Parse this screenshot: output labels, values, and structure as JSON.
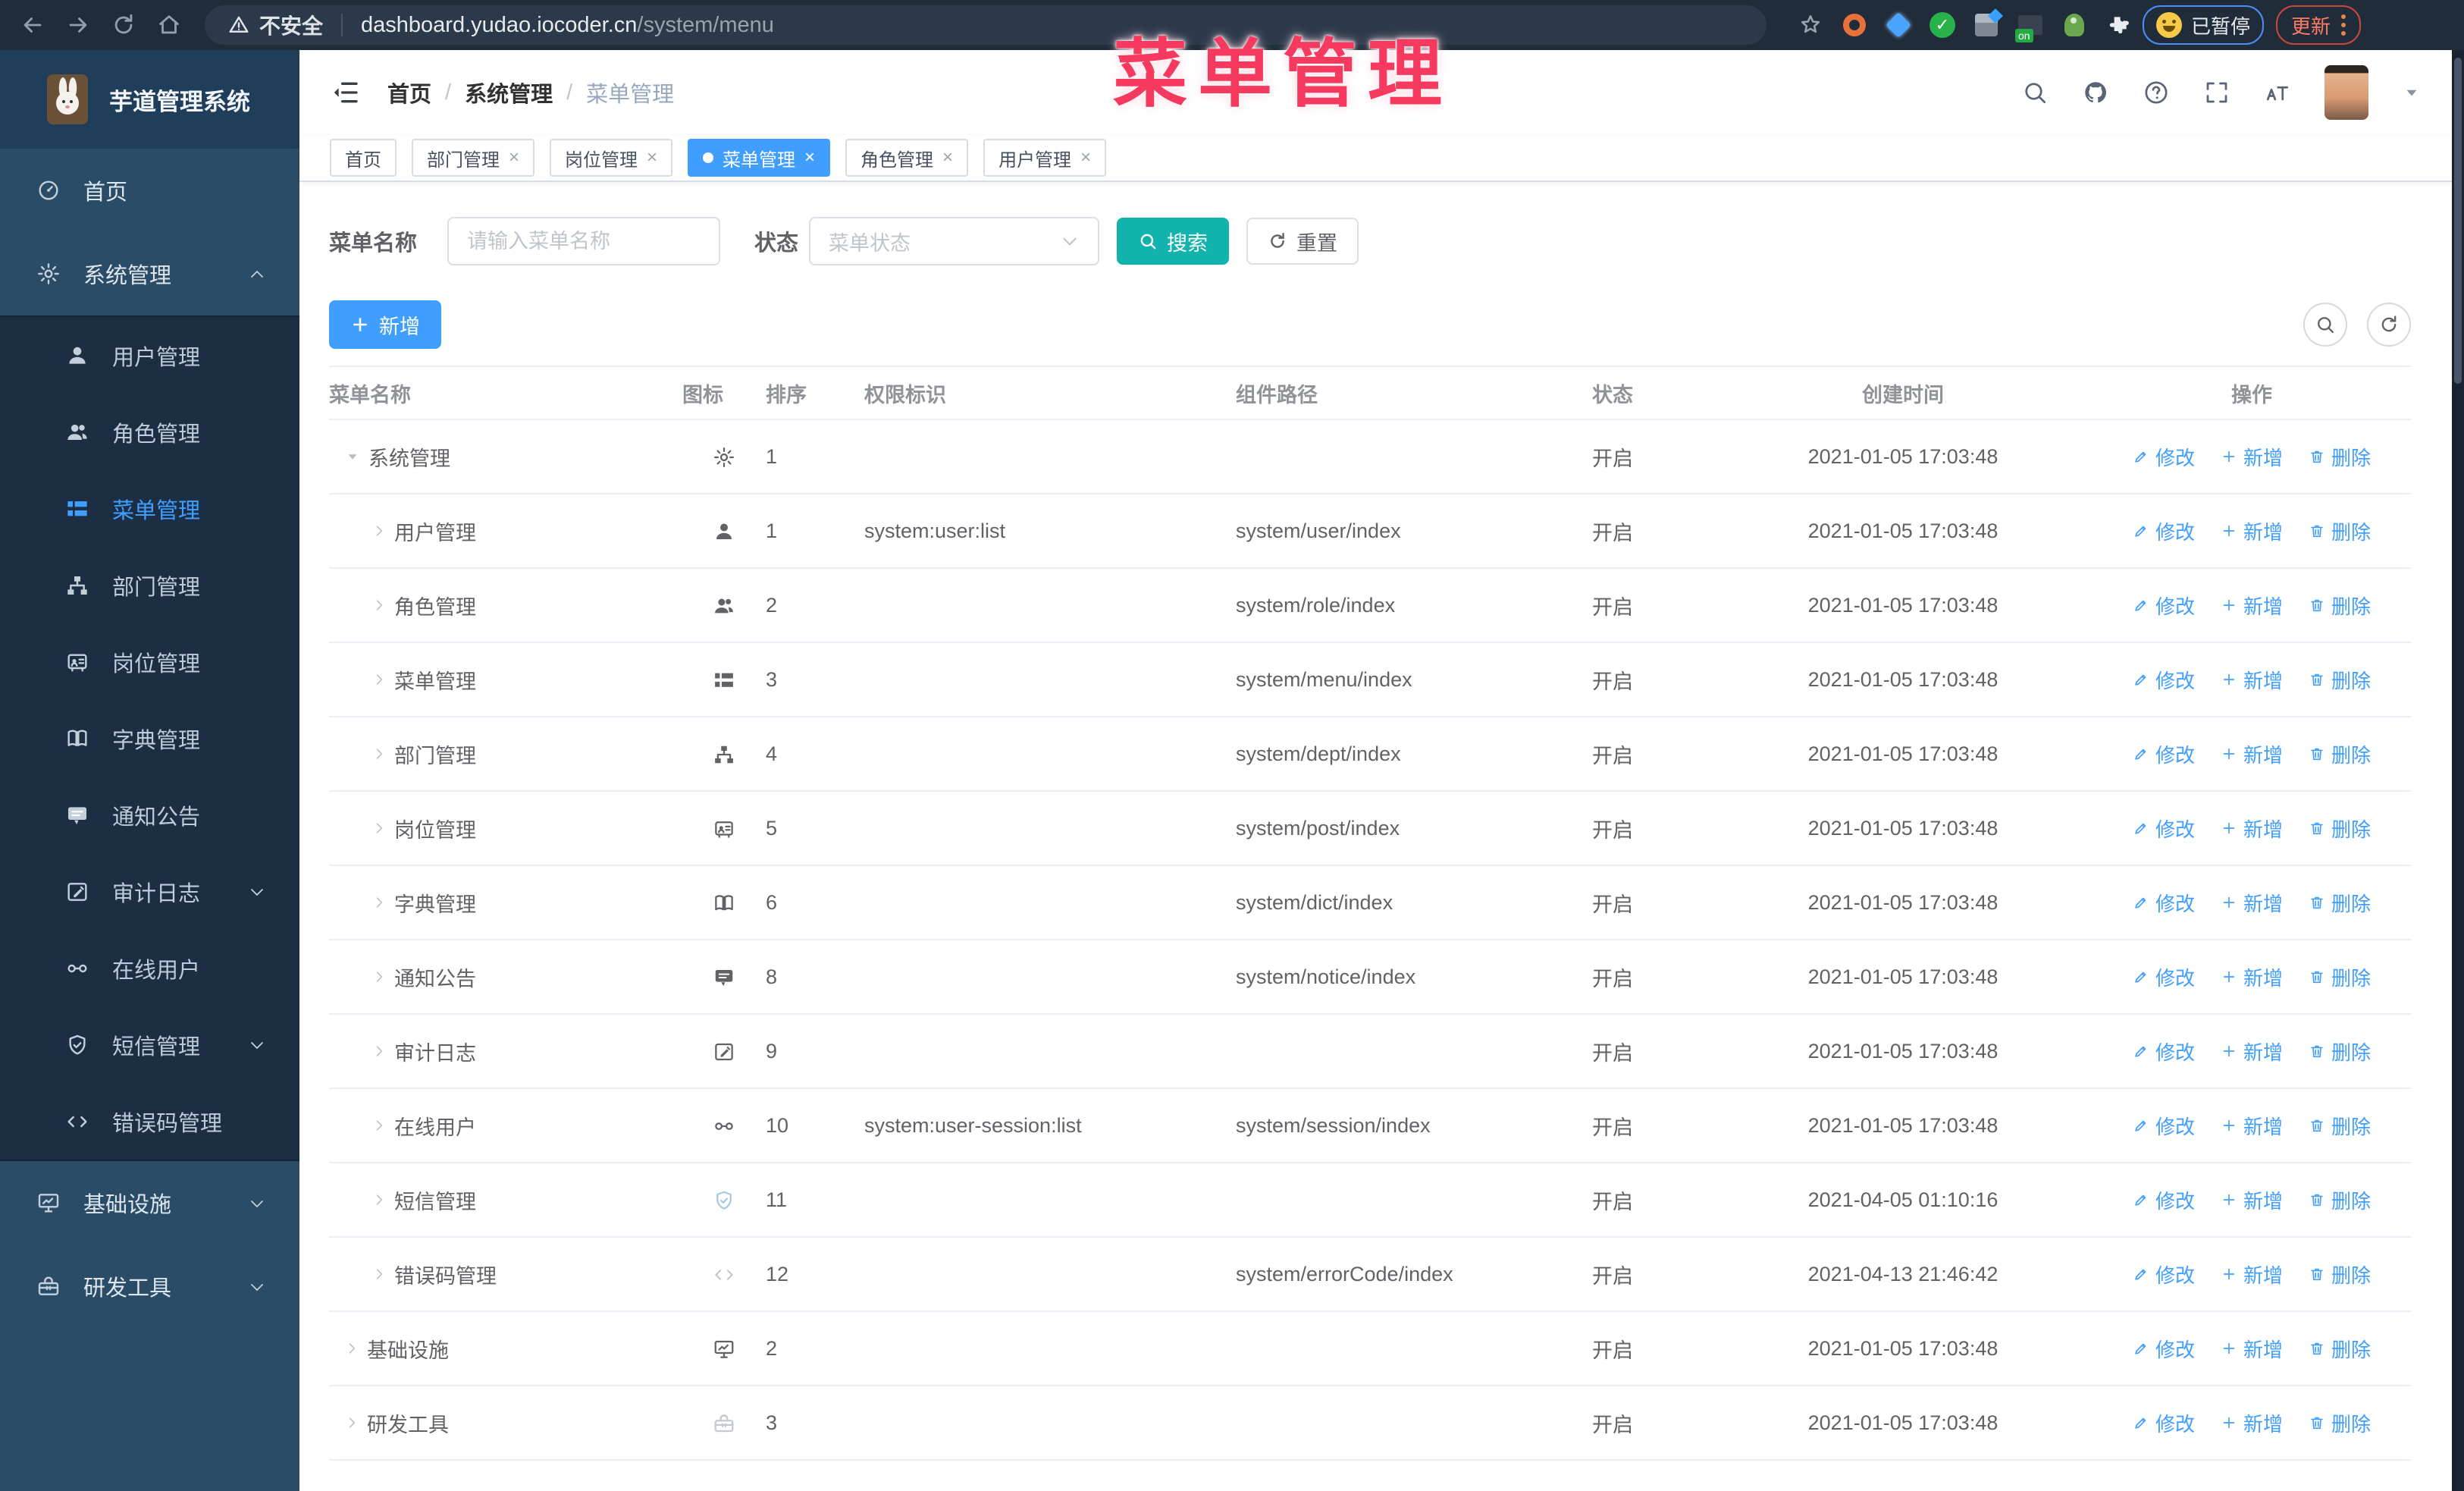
{
  "browser": {
    "security_label": "不安全",
    "url_host": "dashboard.yudao.iocoder.cn",
    "url_path": "/system/menu",
    "paused_badge": "已暂停",
    "update_button": "更新",
    "extensions": [
      {
        "key": "star",
        "name": "bookmark-star-icon"
      },
      {
        "key": "orange-ring",
        "name": "extension-orange-icon"
      },
      {
        "key": "blue-gem",
        "name": "extension-blue-icon"
      },
      {
        "key": "green-check",
        "name": "extension-green-check-icon"
      },
      {
        "key": "grid-diamond",
        "name": "extension-grid-icon"
      },
      {
        "key": "on-badge",
        "name": "extension-on-icon",
        "badge": "on"
      },
      {
        "key": "green-fig",
        "name": "extension-green-icon"
      },
      {
        "key": "puzzle",
        "name": "extensions-puzzle-icon"
      }
    ]
  },
  "overlay_title": "菜单管理",
  "colors": {
    "accent": "#409eff",
    "teal": "#11b3ac",
    "pink_title": "#f5395f",
    "sidebar_bg": "#2a4c66",
    "submenu_bg": "#1c2e44",
    "browser_bar_bg": "#212c3b"
  },
  "sidebar": {
    "logo_title": "芋道管理系统",
    "items": [
      {
        "key": "home",
        "label": "首页",
        "icon": "dashboard",
        "type": "root"
      },
      {
        "key": "system-mgmt",
        "label": "系统管理",
        "icon": "gear",
        "type": "root",
        "arrow": "up"
      },
      {
        "key": "user-mgmt",
        "label": "用户管理",
        "icon": "user",
        "type": "sub"
      },
      {
        "key": "role-mgmt",
        "label": "角色管理",
        "icon": "users",
        "type": "sub"
      },
      {
        "key": "menu-mgmt",
        "label": "菜单管理",
        "icon": "menu",
        "type": "sub",
        "active": true
      },
      {
        "key": "dept-mgmt",
        "label": "部门管理",
        "icon": "tree",
        "type": "sub"
      },
      {
        "key": "post-mgmt",
        "label": "岗位管理",
        "icon": "badge",
        "type": "sub"
      },
      {
        "key": "dict-mgmt",
        "label": "字典管理",
        "icon": "book",
        "type": "sub"
      },
      {
        "key": "notice",
        "label": "通知公告",
        "icon": "message",
        "type": "sub"
      },
      {
        "key": "audit-log",
        "label": "审计日志",
        "icon": "log",
        "type": "sub",
        "arrow": "down"
      },
      {
        "key": "online-user",
        "label": "在线用户",
        "icon": "link",
        "type": "sub"
      },
      {
        "key": "sms-mgmt",
        "label": "短信管理",
        "icon": "shield",
        "type": "sub",
        "arrow": "down"
      },
      {
        "key": "errcode-mgmt",
        "label": "错误码管理",
        "icon": "code",
        "type": "sub"
      },
      {
        "key": "infra",
        "label": "基础设施",
        "icon": "monitor",
        "type": "root",
        "arrow": "down"
      },
      {
        "key": "dev-tool",
        "label": "研发工具",
        "icon": "toolbox",
        "type": "root",
        "arrow": "down"
      }
    ]
  },
  "header": {
    "breadcrumb": [
      "首页",
      "系统管理",
      "菜单管理"
    ],
    "right_icons": [
      "search",
      "github",
      "question",
      "fullscreen",
      "fontsize"
    ]
  },
  "tabs": [
    {
      "key": "home",
      "label": "首页",
      "closable": false,
      "active": false
    },
    {
      "key": "dept",
      "label": "部门管理",
      "closable": true,
      "active": false
    },
    {
      "key": "post",
      "label": "岗位管理",
      "closable": true,
      "active": false
    },
    {
      "key": "menu",
      "label": "菜单管理",
      "closable": true,
      "active": true
    },
    {
      "key": "role",
      "label": "角色管理",
      "closable": true,
      "active": false
    },
    {
      "key": "user",
      "label": "用户管理",
      "closable": true,
      "active": false
    }
  ],
  "filters": {
    "name_label": "菜单名称",
    "name_placeholder": "请输入菜单名称",
    "status_label": "状态",
    "status_placeholder": "菜单状态",
    "search_label": "搜索",
    "reset_label": "重置"
  },
  "toolbar": {
    "add_label": "新增"
  },
  "table": {
    "columns": [
      "菜单名称",
      "图标",
      "排序",
      "权限标识",
      "组件路径",
      "状态",
      "创建时间",
      "操作"
    ],
    "actions": [
      {
        "key": "edit",
        "label": "修改",
        "icon": "edit"
      },
      {
        "key": "add",
        "label": "新增",
        "icon": "plus"
      },
      {
        "key": "delete",
        "label": "删除",
        "icon": "trash"
      }
    ],
    "rows": [
      {
        "key": "system",
        "name": "系统管理",
        "icon": "gear",
        "level": 0,
        "expanded": true,
        "order": "1",
        "perm": "",
        "path": "",
        "status": "开启",
        "created": "2021-01-05 17:03:48"
      },
      {
        "key": "user",
        "name": "用户管理",
        "icon": "user",
        "level": 1,
        "order": "1",
        "perm": "system:user:list",
        "path": "system/user/index",
        "status": "开启",
        "created": "2021-01-05 17:03:48"
      },
      {
        "key": "role",
        "name": "角色管理",
        "icon": "users",
        "level": 1,
        "order": "2",
        "perm": "",
        "path": "system/role/index",
        "status": "开启",
        "created": "2021-01-05 17:03:48"
      },
      {
        "key": "menu",
        "name": "菜单管理",
        "icon": "menu",
        "level": 1,
        "order": "3",
        "perm": "",
        "path": "system/menu/index",
        "status": "开启",
        "created": "2021-01-05 17:03:48"
      },
      {
        "key": "dept",
        "name": "部门管理",
        "icon": "tree",
        "level": 1,
        "order": "4",
        "perm": "",
        "path": "system/dept/index",
        "status": "开启",
        "created": "2021-01-05 17:03:48"
      },
      {
        "key": "post",
        "name": "岗位管理",
        "icon": "badge",
        "level": 1,
        "order": "5",
        "perm": "",
        "path": "system/post/index",
        "status": "开启",
        "created": "2021-01-05 17:03:48"
      },
      {
        "key": "dict",
        "name": "字典管理",
        "icon": "book",
        "level": 1,
        "order": "6",
        "perm": "",
        "path": "system/dict/index",
        "status": "开启",
        "created": "2021-01-05 17:03:48"
      },
      {
        "key": "notice",
        "name": "通知公告",
        "icon": "message",
        "level": 1,
        "order": "8",
        "perm": "",
        "path": "system/notice/index",
        "status": "开启",
        "created": "2021-01-05 17:03:48"
      },
      {
        "key": "audit",
        "name": "审计日志",
        "icon": "log",
        "level": 1,
        "order": "9",
        "perm": "",
        "path": "",
        "status": "开启",
        "created": "2021-01-05 17:03:48"
      },
      {
        "key": "online",
        "name": "在线用户",
        "icon": "link",
        "level": 1,
        "order": "10",
        "perm": "system:user-session:list",
        "path": "system/session/index",
        "status": "开启",
        "created": "2021-01-05 17:03:48"
      },
      {
        "key": "sms",
        "name": "短信管理",
        "icon": "shield",
        "level": 1,
        "order": "11",
        "perm": "",
        "path": "",
        "status": "开启",
        "created": "2021-04-05 01:10:16",
        "icon_tone": "muted-blue"
      },
      {
        "key": "errcode",
        "name": "错误码管理",
        "icon": "code",
        "level": 1,
        "order": "12",
        "perm": "",
        "path": "system/errorCode/index",
        "status": "开启",
        "created": "2021-04-13 21:46:42",
        "icon_tone": "muted-gray"
      },
      {
        "key": "infra",
        "name": "基础设施",
        "icon": "monitor",
        "level": 0,
        "order": "2",
        "perm": "",
        "path": "",
        "status": "开启",
        "created": "2021-01-05 17:03:48"
      },
      {
        "key": "devtool",
        "name": "研发工具",
        "icon": "toolbox",
        "level": 0,
        "order": "3",
        "perm": "",
        "path": "",
        "status": "开启",
        "created": "2021-01-05 17:03:48",
        "icon_tone": "muted-gray"
      }
    ]
  }
}
